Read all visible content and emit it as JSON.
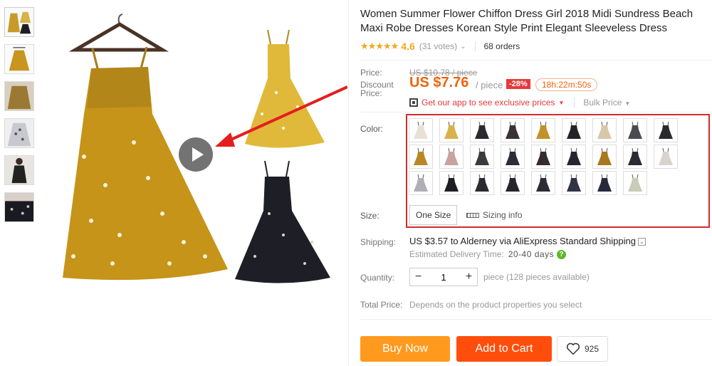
{
  "gallery": {
    "thumbnails": [
      {
        "name": "thumb-yellow-and-black",
        "colors": [
          "#c89a2a",
          "#1e1e22"
        ]
      },
      {
        "name": "thumb-yellow-hanger",
        "colors": [
          "#c8961e"
        ]
      },
      {
        "name": "thumb-yellow-closeup",
        "colors": [
          "#9a7a32"
        ]
      },
      {
        "name": "thumb-white-floral",
        "colors": [
          "#d8d8dc"
        ]
      },
      {
        "name": "thumb-model-black",
        "colors": [
          "#222"
        ]
      },
      {
        "name": "thumb-black-fabric",
        "colors": [
          "#1a1a22"
        ]
      }
    ],
    "play_icon": "play-icon"
  },
  "product": {
    "title": "Women Summer Flower Chiffon Dress Girl 2018 Midi Sundress Beach Maxi Robe Dresses Korean Style Print Elegant Sleeveless Dress",
    "rating": {
      "stars": "★★★★★",
      "value": "4.6",
      "votes": "(31 votes)"
    },
    "orders": "68 orders"
  },
  "price": {
    "price_label": "Price:",
    "original": "US $10.78 / piece",
    "discount_label": "Discount Price:",
    "discount": "US $7.76",
    "per_piece": "/ piece",
    "off": "-28%",
    "timer": "18h:22m:50s",
    "app_link": "Get our app to see exclusive prices",
    "bulk": "Bulk Price"
  },
  "options": {
    "color_label": "Color:",
    "size_label": "Size:",
    "size_value": "One Size",
    "sizing_info": "Sizing info",
    "swatches": [
      "#e8e0d4",
      "#d8b24a",
      "#2a2a30",
      "#3a3238",
      "#c0922a",
      "#23232a",
      "#d6c8a8",
      "#4a4a50",
      "#2a2a2e",
      "#b98628",
      "#c9a3a0",
      "#3a3a40",
      "#2a2c38",
      "#352a30",
      "#262630",
      "#a8781e",
      "#2e2a34",
      "#d8d4cc",
      "#b0aeb8",
      "#1e1e24",
      "#2a2a30",
      "#25252c",
      "#2c2c34",
      "#303446",
      "#262a3a",
      "#c8ccb8"
    ]
  },
  "shipping": {
    "label": "Shipping:",
    "text": "US $3.57 to Alderney via AliExpress Standard Shipping",
    "delivery_label": "Estimated Delivery Time:",
    "delivery_value": "20-40 days",
    "help": "?"
  },
  "quantity": {
    "label": "Quantity:",
    "minus": "−",
    "value": "1",
    "plus": "+",
    "note": "piece (128 pieces available)"
  },
  "total": {
    "label": "Total Price:",
    "text": "Depends on the product properties you select"
  },
  "actions": {
    "buy_now": "Buy Now",
    "add_to_cart": "Add to Cart",
    "wish_count": "925"
  },
  "colors": {
    "accent_orange": "#f0620a",
    "buy_now_bg": "#ff9a1e",
    "add_to_cart_bg": "#ff4e0c",
    "highlight_red": "#d42a2a",
    "star": "#f0a91e"
  }
}
